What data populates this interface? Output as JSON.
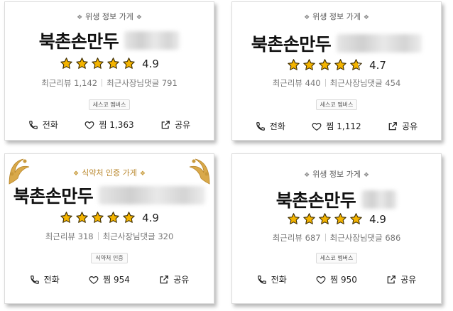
{
  "cards": [
    {
      "tag": "위생 정보 가게",
      "name": "북촌손만두",
      "rating": 4.9,
      "rating_text": "4.9",
      "recent_reviews": "최근리뷰 1,142",
      "owner_replies": "최근사장님댓글 791",
      "badge": "세스코 멤버스",
      "call_label": "전화",
      "like_label": "찜 1,363",
      "share_label": "공유"
    },
    {
      "tag": "위생 정보 가게",
      "name": "북촌손만두",
      "rating": 4.7,
      "rating_text": "4.7",
      "recent_reviews": "최근리뷰 440",
      "owner_replies": "최근사장님댓글 454",
      "badge": "세스코 멤버스",
      "call_label": "전화",
      "like_label": "찜 1,112",
      "share_label": "공유"
    },
    {
      "tag": "식약처 인증 가게",
      "name": "북촌손만두",
      "rating": 4.9,
      "rating_text": "4.9",
      "recent_reviews": "최근리뷰 318",
      "owner_replies": "최근사장님댓글 320",
      "badge": "식약처 인증",
      "call_label": "전화",
      "like_label": "찜 954",
      "share_label": "공유"
    },
    {
      "tag": "위생 정보 가게",
      "name": "북촌손만두",
      "rating": 4.9,
      "rating_text": "4.9",
      "recent_reviews": "최근리뷰 687",
      "owner_replies": "최근사장님댓글 686",
      "badge": "세스코 멤버스",
      "call_label": "전화",
      "like_label": "찜 950",
      "share_label": "공유"
    }
  ],
  "colors": {
    "star": "#f4b400",
    "gold_tag": "#b8862a",
    "border": "#dcdcdc"
  }
}
